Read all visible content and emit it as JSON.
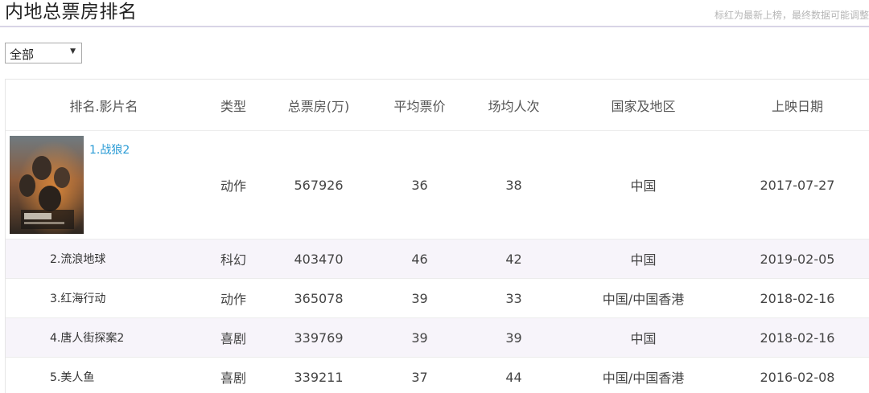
{
  "page": {
    "title": "内地总票房排名",
    "note": "标红为最新上榜，最终数据可能调整"
  },
  "filter": {
    "selected": "全部"
  },
  "table": {
    "headers": [
      "排名.影片名",
      "类型",
      "总票房(万)",
      "平均票价",
      "场均人次",
      "国家及地区",
      "上映日期"
    ],
    "rows": [
      {
        "name": "1.战狼2",
        "genre": "动作",
        "box_office": "567926",
        "avg_price": "36",
        "avg_attendance": "38",
        "region": "中国",
        "release_date": "2017-07-27"
      },
      {
        "name": "2.流浪地球",
        "genre": "科幻",
        "box_office": "403470",
        "avg_price": "46",
        "avg_attendance": "42",
        "region": "中国",
        "release_date": "2019-02-05"
      },
      {
        "name": "3.红海行动",
        "genre": "动作",
        "box_office": "365078",
        "avg_price": "39",
        "avg_attendance": "33",
        "region": "中国/中国香港",
        "release_date": "2018-02-16"
      },
      {
        "name": "4.唐人街探案2",
        "genre": "喜剧",
        "box_office": "339769",
        "avg_price": "39",
        "avg_attendance": "39",
        "region": "中国",
        "release_date": "2018-02-16"
      },
      {
        "name": "5.美人鱼",
        "genre": "喜剧",
        "box_office": "339211",
        "avg_price": "37",
        "avg_attendance": "44",
        "region": "中国/中国香港",
        "release_date": "2016-02-08"
      }
    ]
  },
  "colors": {
    "link": "#2a9bd5",
    "alt_row": "#f7f4fa",
    "rule": "#d8d4e6"
  }
}
